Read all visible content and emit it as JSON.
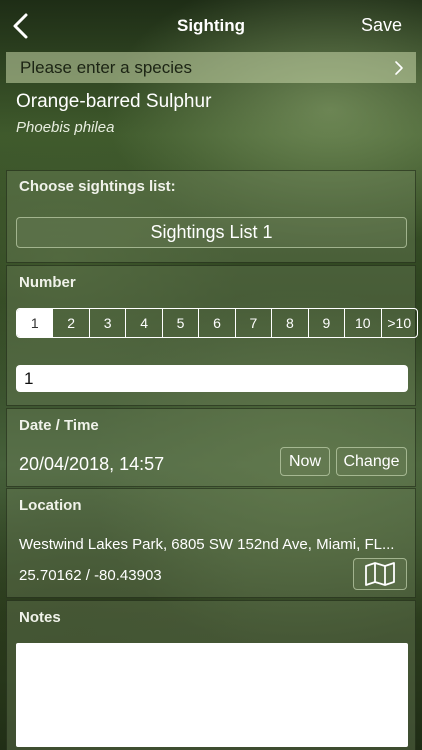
{
  "nav": {
    "title": "Sighting",
    "save_label": "Save",
    "back_icon": "chevron-left-icon"
  },
  "species": {
    "prompt": "Please enter a species",
    "chevron_icon": "chevron-right-icon",
    "common_name": "Orange-barred Sulphur",
    "latin_name": "Phoebis philea"
  },
  "sightings_list": {
    "label": "Choose sightings list:",
    "selected": "Sightings List 1"
  },
  "number": {
    "label": "Number",
    "options": [
      "1",
      "2",
      "3",
      "4",
      "5",
      "6",
      "7",
      "8",
      "9",
      "10",
      ">10"
    ],
    "selected": "1",
    "value": "1"
  },
  "datetime": {
    "label": "Date / Time",
    "value": "20/04/2018, 14:57",
    "now_label": "Now",
    "change_label": "Change"
  },
  "location": {
    "label": "Location",
    "address": "Westwind Lakes Park, 6805 SW 152nd Ave, Miami, FL...",
    "coords": "25.70162 / -80.43903",
    "map_icon": "map-icon"
  },
  "notes": {
    "label": "Notes",
    "value": ""
  },
  "colors": {
    "segment_selected_bg": "#ffffff",
    "species_bar": "#c8d7aa",
    "panel_border": "#141e0c"
  }
}
